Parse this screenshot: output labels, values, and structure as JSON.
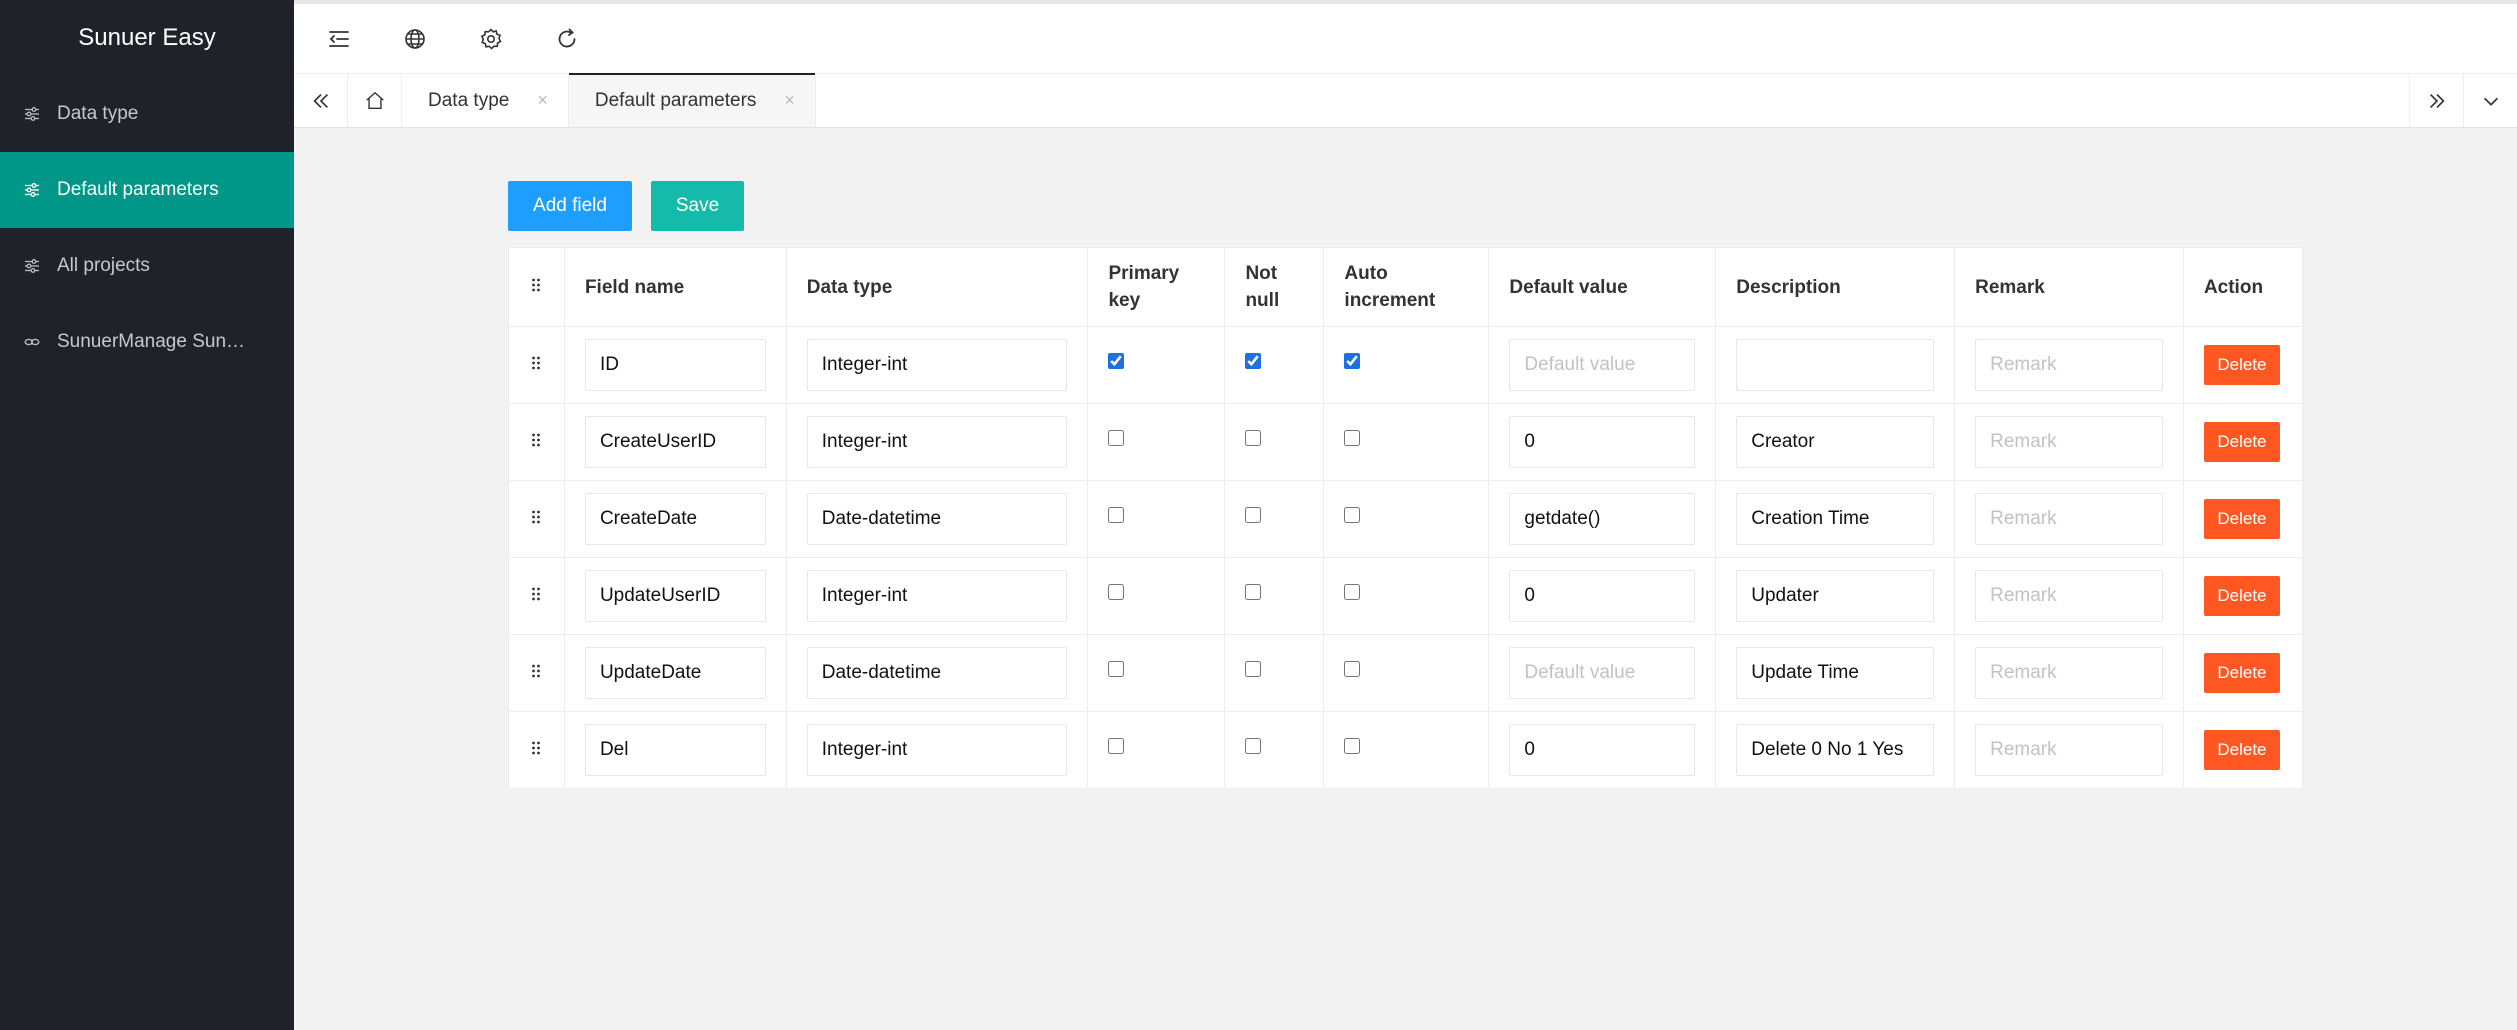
{
  "app": {
    "title": "Sunuer Easy"
  },
  "sidebar": {
    "items": [
      {
        "label": "Data type",
        "icon": "sliders-icon",
        "active": false
      },
      {
        "label": "Default parameters",
        "icon": "sliders-icon",
        "active": true
      },
      {
        "label": "All projects",
        "icon": "sliders-icon",
        "active": false
      },
      {
        "label": "SunuerManage Sun…",
        "icon": "link-icon",
        "active": false
      }
    ]
  },
  "header": {
    "icons": [
      "menu-fold-icon",
      "globe-icon",
      "gear-icon",
      "refresh-icon"
    ]
  },
  "tabs": [
    {
      "label": "Data type",
      "close": "×",
      "active": false
    },
    {
      "label": "Default parameters",
      "close": "×",
      "active": true
    }
  ],
  "toolbar": {
    "add_label": "Add field",
    "save_label": "Save"
  },
  "table": {
    "headers": {
      "field_name": "Field name",
      "data_type": "Data type",
      "primary_key_1": "Primary",
      "primary_key_2": "key",
      "not_null_1": "Not",
      "not_null_2": "null",
      "auto_inc_1": "Auto",
      "auto_inc_2": "increment",
      "default_value": "Default value",
      "description": "Description",
      "remark": "Remark",
      "action": "Action"
    },
    "placeholders": {
      "default_value": "Default value",
      "remark": "Remark"
    },
    "delete_label": "Delete",
    "rows": [
      {
        "field": "ID",
        "type": "Integer-int",
        "pk": true,
        "nn": true,
        "ai": true,
        "default": "",
        "desc": "",
        "remark": ""
      },
      {
        "field": "CreateUserID",
        "type": "Integer-int",
        "pk": false,
        "nn": false,
        "ai": false,
        "default": "0",
        "desc": "Creator",
        "remark": ""
      },
      {
        "field": "CreateDate",
        "type": "Date-datetime",
        "pk": false,
        "nn": false,
        "ai": false,
        "default": "getdate()",
        "desc": "Creation Time",
        "remark": ""
      },
      {
        "field": "UpdateUserID",
        "type": "Integer-int",
        "pk": false,
        "nn": false,
        "ai": false,
        "default": "0",
        "desc": "Updater",
        "remark": ""
      },
      {
        "field": "UpdateDate",
        "type": "Date-datetime",
        "pk": false,
        "nn": false,
        "ai": false,
        "default": "",
        "desc": "Update Time",
        "remark": ""
      },
      {
        "field": "Del",
        "type": "Integer-int",
        "pk": false,
        "nn": false,
        "ai": false,
        "default": "0",
        "desc": "Delete 0 No 1 Yes",
        "remark": ""
      }
    ]
  }
}
